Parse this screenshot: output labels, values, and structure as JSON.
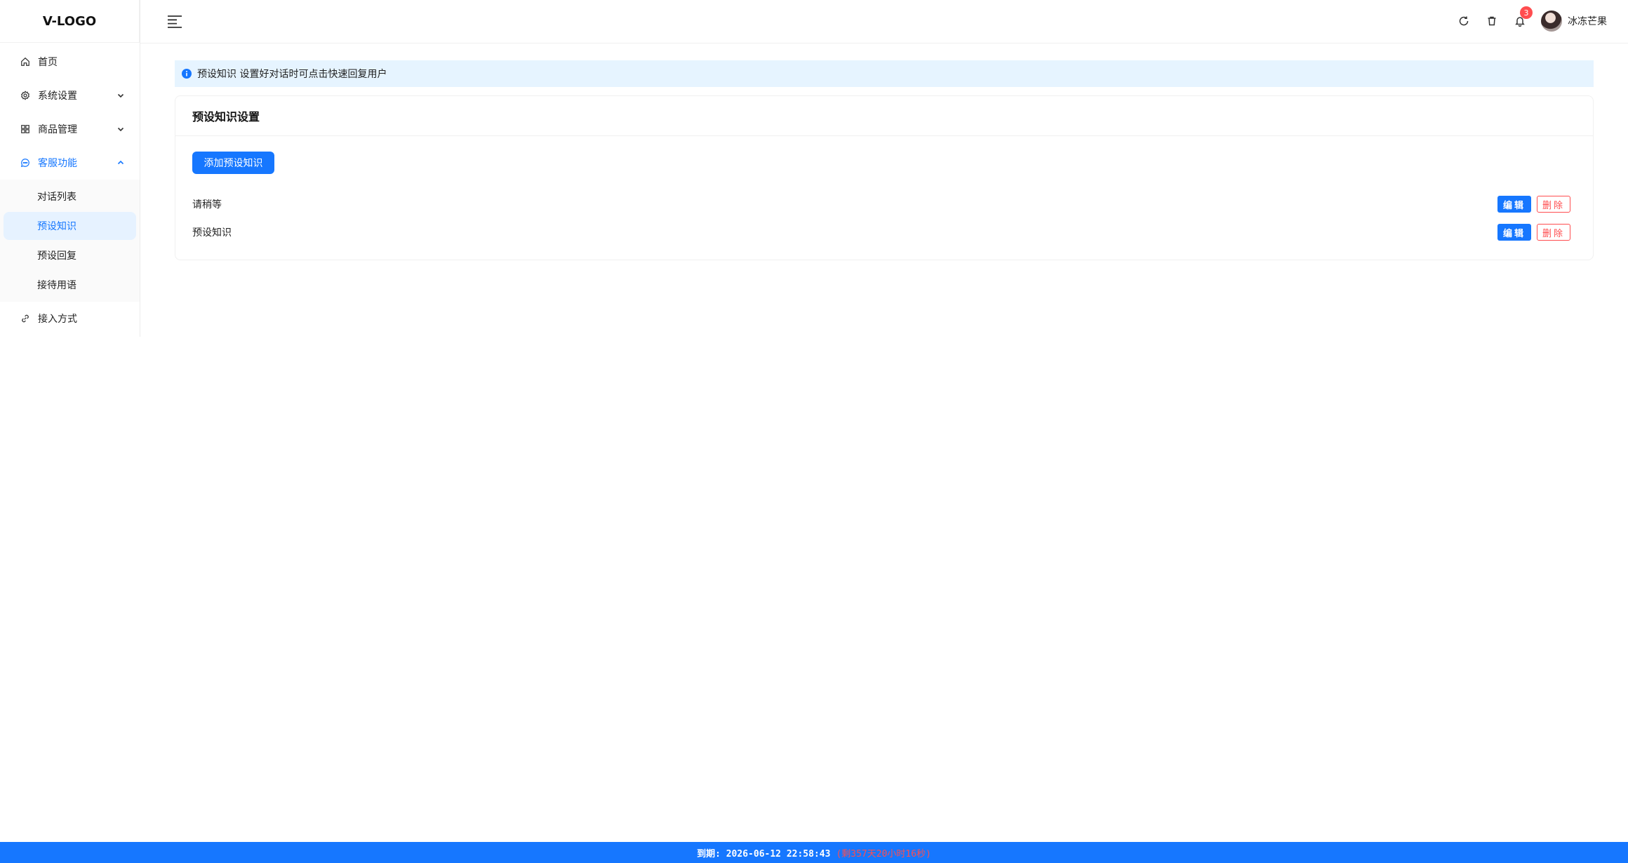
{
  "logo": "V-LOGO",
  "sidebar": {
    "items": [
      {
        "label": "首页",
        "icon": "home-icon"
      },
      {
        "label": "系统设置",
        "icon": "gear-icon"
      },
      {
        "label": "商品管理",
        "icon": "grid-icon"
      },
      {
        "label": "客服功能",
        "icon": "chat-icon"
      },
      {
        "label": "接入方式",
        "icon": "link-icon"
      }
    ],
    "sub_items": [
      {
        "label": "对话列表"
      },
      {
        "label": "预设知识"
      },
      {
        "label": "预设回复"
      },
      {
        "label": "接待用语"
      }
    ]
  },
  "header": {
    "notification_count": "3",
    "username": "冰冻芒果"
  },
  "alert": {
    "text": "预设知识 设置好对话时可点击快速回复用户"
  },
  "card": {
    "title": "预设知识设置",
    "add_button": "添加预设知识",
    "rows": [
      {
        "text": "请稍等",
        "edit": "编辑",
        "delete": "删除"
      },
      {
        "text": "预设知识",
        "edit": "编辑",
        "delete": "删除"
      }
    ]
  },
  "footer": {
    "expiry": "到期: 2026-06-12 22:58:43",
    "remaining": "(剩357天20小时16秒)"
  },
  "colors": {
    "accent": "#1677ff",
    "danger": "#ff4d4f",
    "selected_bg": "#e6f2ff",
    "alert_bg": "#e6f4ff"
  }
}
